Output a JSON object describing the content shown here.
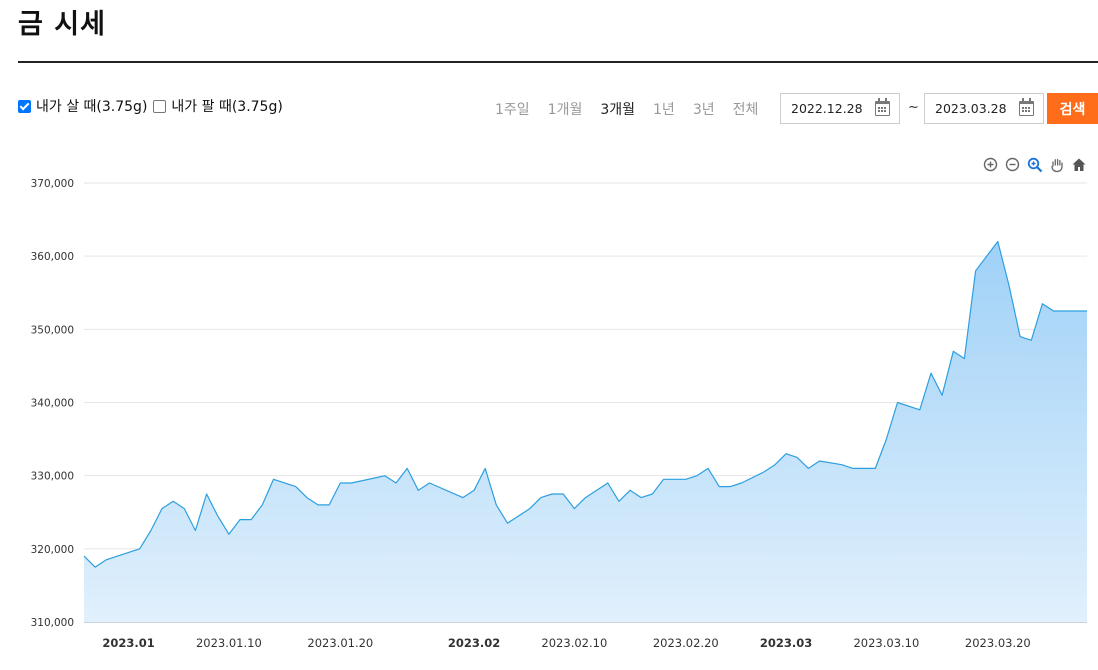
{
  "page": {
    "title": "금 시세"
  },
  "filters": {
    "buy_label": "내가 살 때(3.75g)",
    "buy_checked": true,
    "sell_label": "내가 팔 때(3.75g)",
    "sell_checked": false
  },
  "periods": [
    {
      "label": "1주일",
      "active": false
    },
    {
      "label": "1개월",
      "active": false
    },
    {
      "label": "3개월",
      "active": true
    },
    {
      "label": "1년",
      "active": false
    },
    {
      "label": "3년",
      "active": false
    },
    {
      "label": "전체",
      "active": false
    }
  ],
  "date_range": {
    "from": "2022.12.28",
    "separator": "~",
    "to": "2023.03.28"
  },
  "search_label": "검색",
  "toolbar_icons": [
    "zoom-in-icon",
    "zoom-out-icon",
    "zoom-select-icon",
    "pan-hand-icon",
    "home-icon"
  ],
  "colors": {
    "line": "#2d9fe0",
    "fill_top": "#9fd1f7",
    "fill_bottom": "#e1f0fc",
    "accent": "#ff6c1a",
    "checkbox": "#0075ff"
  },
  "chart_data": {
    "type": "area",
    "series": [
      {
        "points": [
          [
            "2022-12-28",
            319000
          ],
          [
            "2022-12-29",
            317500
          ],
          [
            "2022-12-30",
            318500
          ],
          [
            "2023-01-02",
            320000
          ],
          [
            "2023-01-03",
            322500
          ],
          [
            "2023-01-04",
            325500
          ],
          [
            "2023-01-05",
            326500
          ],
          [
            "2023-01-06",
            325500
          ],
          [
            "2023-01-07",
            322500
          ],
          [
            "2023-01-08",
            327500
          ],
          [
            "2023-01-09",
            324500
          ],
          [
            "2023-01-10",
            322000
          ],
          [
            "2023-01-11",
            324000
          ],
          [
            "2023-01-12",
            324000
          ],
          [
            "2023-01-13",
            326000
          ],
          [
            "2023-01-14",
            329500
          ],
          [
            "2023-01-16",
            328500
          ],
          [
            "2023-01-17",
            327000
          ],
          [
            "2023-01-18",
            326000
          ],
          [
            "2023-01-19",
            326000
          ],
          [
            "2023-01-20",
            329000
          ],
          [
            "2023-01-21",
            329000
          ],
          [
            "2023-01-24",
            330000
          ],
          [
            "2023-01-25",
            329000
          ],
          [
            "2023-01-26",
            331000
          ],
          [
            "2023-01-27",
            328000
          ],
          [
            "2023-01-28",
            329000
          ],
          [
            "2023-01-31",
            327000
          ],
          [
            "2023-02-01",
            328000
          ],
          [
            "2023-02-02",
            331000
          ],
          [
            "2023-02-03",
            326000
          ],
          [
            "2023-02-04",
            323500
          ],
          [
            "2023-02-06",
            325500
          ],
          [
            "2023-02-07",
            327000
          ],
          [
            "2023-02-08",
            327500
          ],
          [
            "2023-02-09",
            327500
          ],
          [
            "2023-02-10",
            325500
          ],
          [
            "2023-02-11",
            327000
          ],
          [
            "2023-02-13",
            329000
          ],
          [
            "2023-02-14",
            326500
          ],
          [
            "2023-02-15",
            328000
          ],
          [
            "2023-02-16",
            327000
          ],
          [
            "2023-02-17",
            327500
          ],
          [
            "2023-02-18",
            329500
          ],
          [
            "2023-02-20",
            329500
          ],
          [
            "2023-02-21",
            330000
          ],
          [
            "2023-02-22",
            331000
          ],
          [
            "2023-02-23",
            328500
          ],
          [
            "2023-02-24",
            328500
          ],
          [
            "2023-02-25",
            329000
          ],
          [
            "2023-02-27",
            330500
          ],
          [
            "2023-02-28",
            331500
          ],
          [
            "2023-03-01",
            333000
          ],
          [
            "2023-03-02",
            332500
          ],
          [
            "2023-03-03",
            331000
          ],
          [
            "2023-03-04",
            332000
          ],
          [
            "2023-03-06",
            331500
          ],
          [
            "2023-03-07",
            331000
          ],
          [
            "2023-03-08",
            331000
          ],
          [
            "2023-03-09",
            331000
          ],
          [
            "2023-03-10",
            335000
          ],
          [
            "2023-03-11",
            340000
          ],
          [
            "2023-03-13",
            339000
          ],
          [
            "2023-03-14",
            344000
          ],
          [
            "2023-03-15",
            341000
          ],
          [
            "2023-03-16",
            347000
          ],
          [
            "2023-03-17",
            346000
          ],
          [
            "2023-03-18",
            358000
          ],
          [
            "2023-03-20",
            362000
          ],
          [
            "2023-03-21",
            356000
          ],
          [
            "2023-03-22",
            349000
          ],
          [
            "2023-03-23",
            348500
          ],
          [
            "2023-03-24",
            353500
          ],
          [
            "2023-03-25",
            352500
          ],
          [
            "2023-03-28",
            352500
          ]
        ]
      }
    ],
    "x_range": [
      "2022-12-28",
      "2023-03-28"
    ],
    "ylim": [
      310000,
      370000
    ],
    "y_ticks": [
      "310,000",
      "320,000",
      "330,000",
      "340,000",
      "350,000",
      "360,000",
      "370,000"
    ],
    "y_tick_values": [
      310000,
      320000,
      330000,
      340000,
      350000,
      360000,
      370000
    ],
    "x_ticks": [
      {
        "date": "2023-01-01",
        "label": "2023.01",
        "bold": true
      },
      {
        "date": "2023-01-10",
        "label": "2023.01.10",
        "bold": false
      },
      {
        "date": "2023-01-20",
        "label": "2023.01.20",
        "bold": false
      },
      {
        "date": "2023-02-01",
        "label": "2023.02",
        "bold": true
      },
      {
        "date": "2023-02-10",
        "label": "2023.02.10",
        "bold": false
      },
      {
        "date": "2023-02-20",
        "label": "2023.02.20",
        "bold": false
      },
      {
        "date": "2023-03-01",
        "label": "2023.03",
        "bold": true
      },
      {
        "date": "2023-03-10",
        "label": "2023.03.10",
        "bold": false
      },
      {
        "date": "2023-03-20",
        "label": "2023.03.20",
        "bold": false
      }
    ],
    "grid": true,
    "legend": "none"
  }
}
